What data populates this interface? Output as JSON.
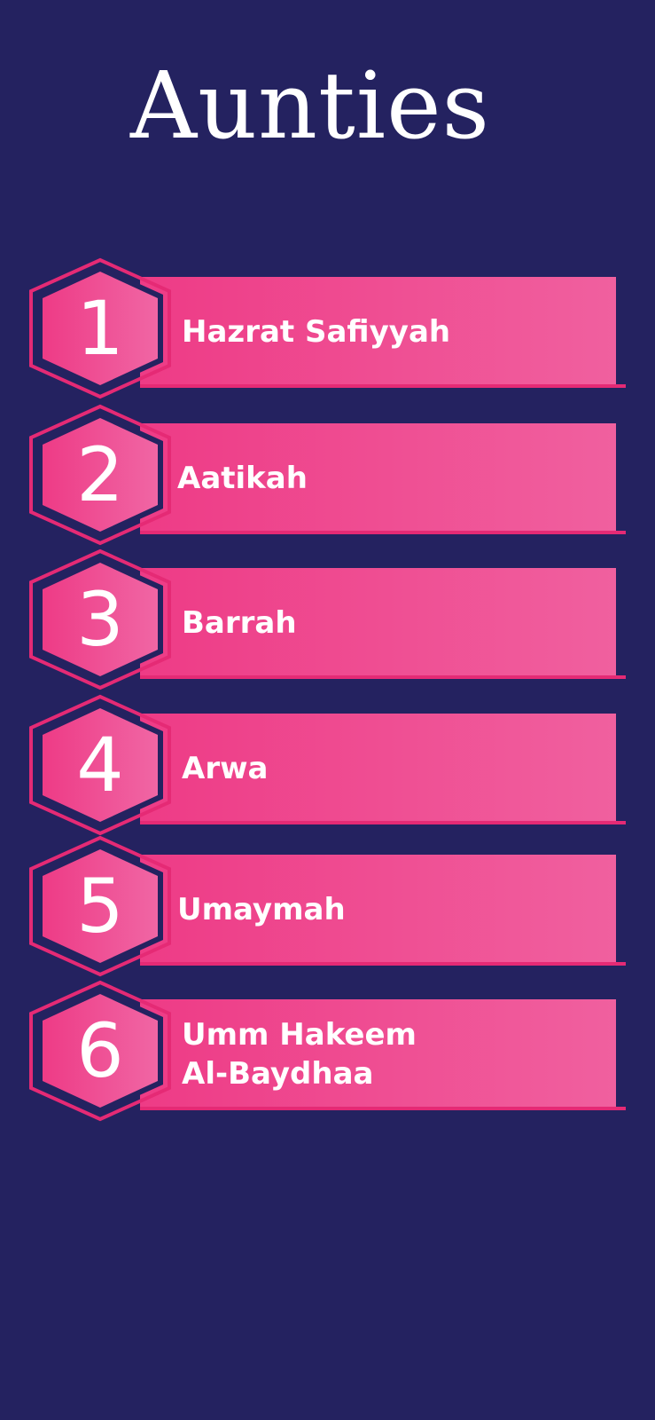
{
  "title": "Aunties",
  "colors": {
    "background": "#242260",
    "band_start": "#ee3b86",
    "band_end": "#f0609f",
    "hex_outline": "#e52a75",
    "text": "#ffffff"
  },
  "items": [
    {
      "number": "1",
      "name": "Hazrat Safiyyah"
    },
    {
      "number": "2",
      "name": "Aatikah"
    },
    {
      "number": "3",
      "name": "Barrah"
    },
    {
      "number": "4",
      "name": "Arwa"
    },
    {
      "number": "5",
      "name": "Umaymah"
    },
    {
      "number": "6",
      "name": "Umm Hakeem\nAl-Baydhaa"
    }
  ]
}
